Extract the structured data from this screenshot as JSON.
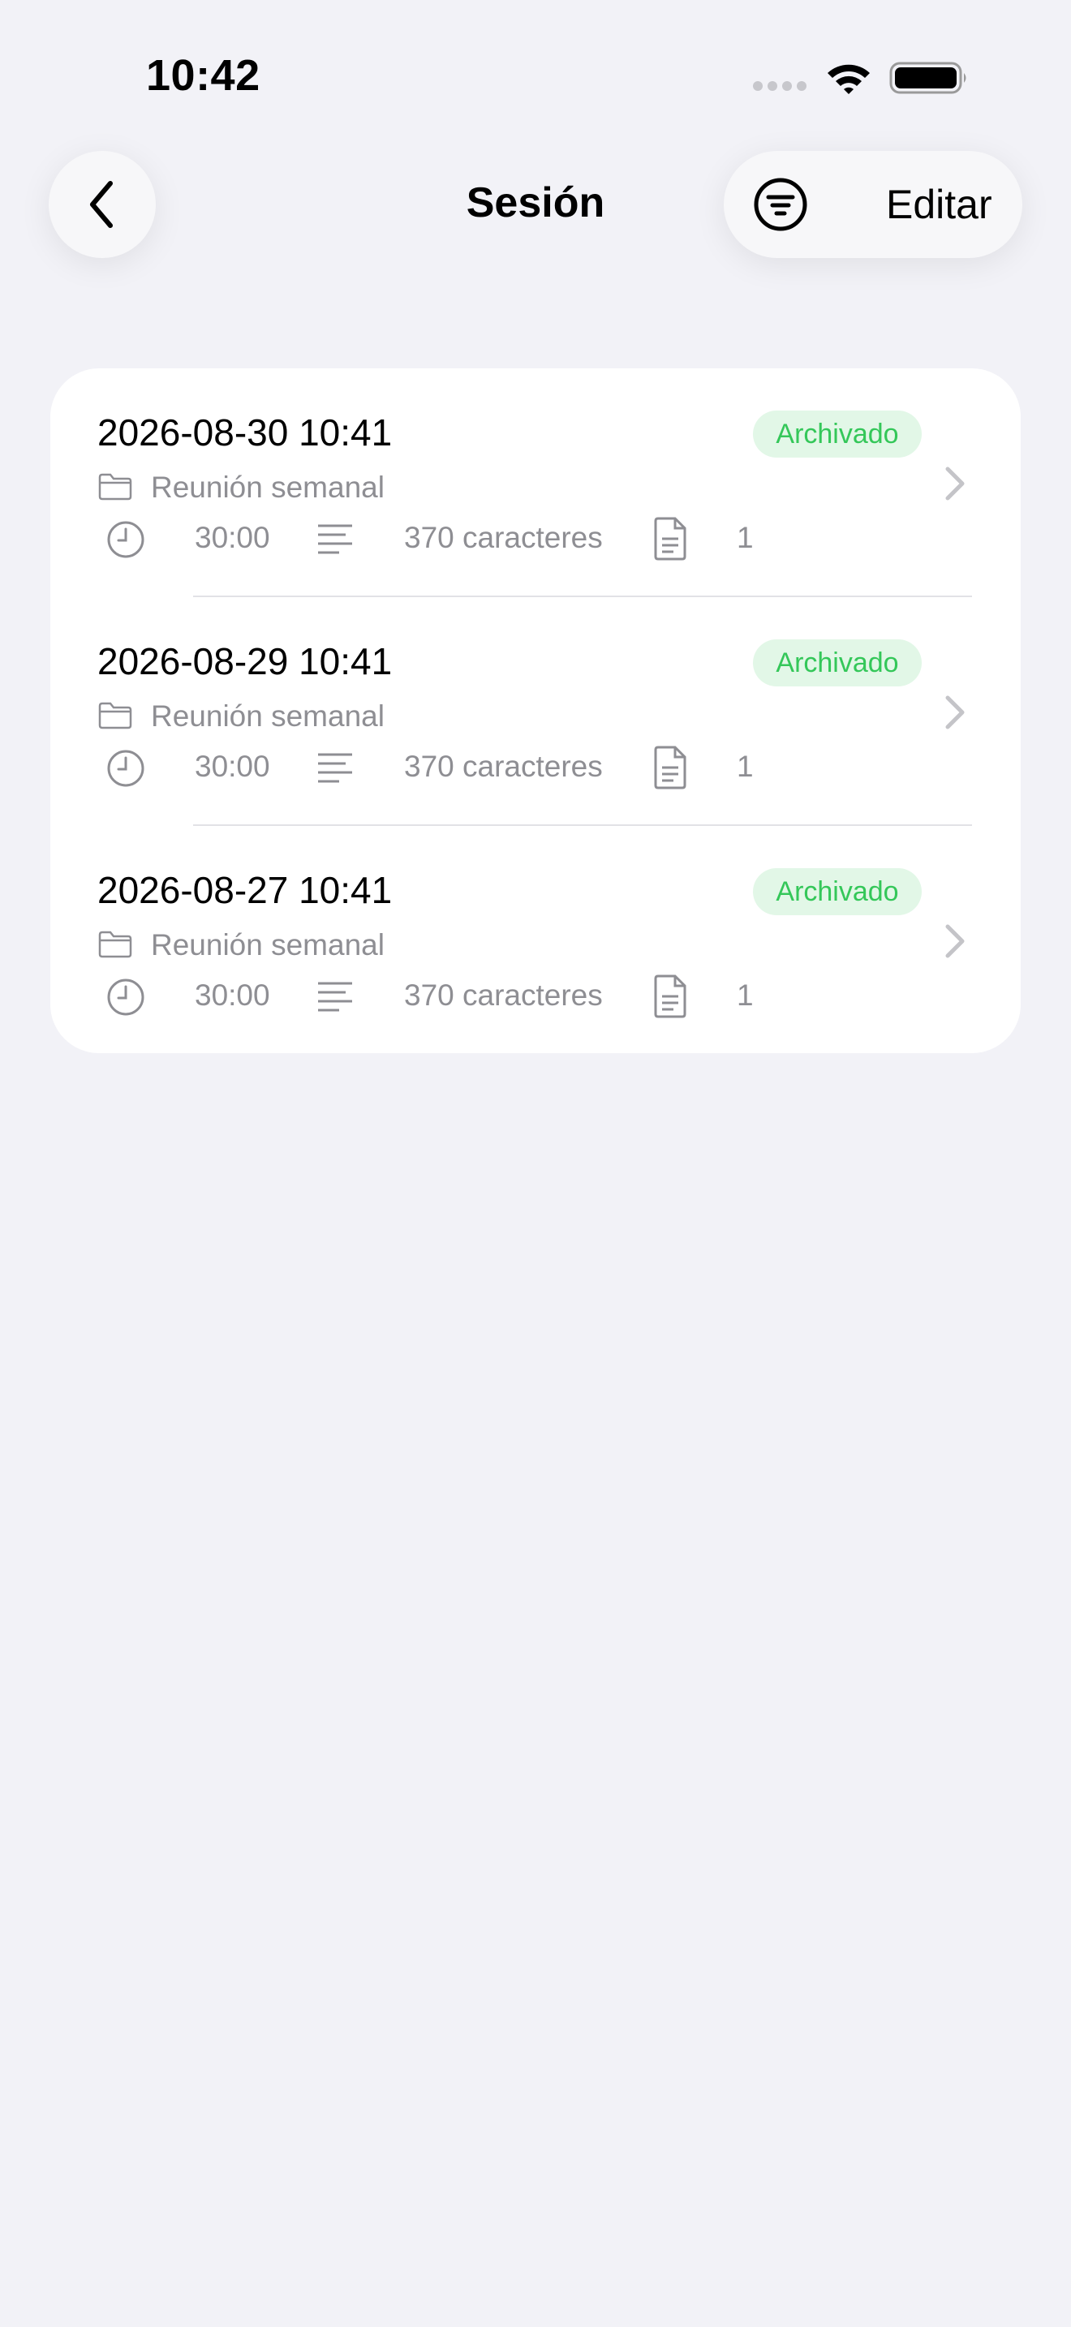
{
  "status_bar": {
    "time": "10:42",
    "icons": [
      "signal-icon",
      "wifi-icon",
      "battery-icon"
    ]
  },
  "nav": {
    "back_icon": "chevron-left-icon",
    "title": "Sesión",
    "filter_icon": "filter-icon",
    "edit_label": "Editar"
  },
  "colors": {
    "background": "#f2f2f7",
    "card": "#ffffff",
    "badge_bg": "#e2f7e7",
    "badge_text": "#34c759",
    "secondary_text": "#8e8e93"
  },
  "sessions": [
    {
      "date": "2026-08-30 10:41",
      "status": "Archivado",
      "folder": "Reunión semanal",
      "duration": "30:00",
      "chars": "370 caracteres",
      "docs": "1"
    },
    {
      "date": "2026-08-29 10:41",
      "status": "Archivado",
      "folder": "Reunión semanal",
      "duration": "30:00",
      "chars": "370 caracteres",
      "docs": "1"
    },
    {
      "date": "2026-08-27 10:41",
      "status": "Archivado",
      "folder": "Reunión semanal",
      "duration": "30:00",
      "chars": "370 caracteres",
      "docs": "1"
    }
  ]
}
